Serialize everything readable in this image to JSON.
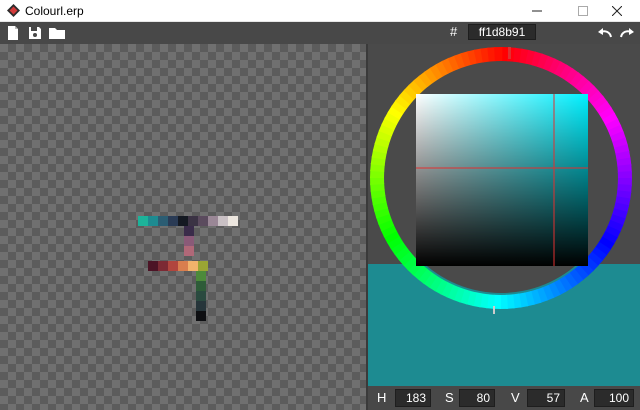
{
  "window": {
    "title": "Colourl.erp",
    "minimize": "—",
    "close": "✕"
  },
  "toolbar": {
    "hash_label": "#",
    "hex_value": "ff1d8b91"
  },
  "color": {
    "hex": "#1d8b91",
    "h": "183",
    "s": "80",
    "v": "57",
    "a": "100"
  },
  "hsva": {
    "h_label": "H",
    "s_label": "S",
    "v_label": "V",
    "a_label": "A"
  },
  "icons": {
    "new": "new-file-icon",
    "save": "save-icon",
    "open": "folder-icon",
    "undo": "undo-icon",
    "redo": "redo-icon"
  },
  "palette": {
    "row1": [
      "#1cb39a",
      "#1d8b91",
      "#2b5d73",
      "#2a3b55",
      "#141922",
      "#3b3344",
      "#5b4b5e",
      "#9a8796",
      "#c9c0c4",
      "#ece6df"
    ],
    "column": [
      "#3a2c4a",
      "#8a5a78",
      "#b06878"
    ],
    "row2": [
      "#4c1426",
      "#7c2a34",
      "#b1463e",
      "#d97e4e",
      "#f2b36b",
      "#9aa534"
    ],
    "column2": [
      "#4c8a3a",
      "#2e5c38",
      "#2a4a3f",
      "#26353a",
      "#0e0f12"
    ]
  }
}
